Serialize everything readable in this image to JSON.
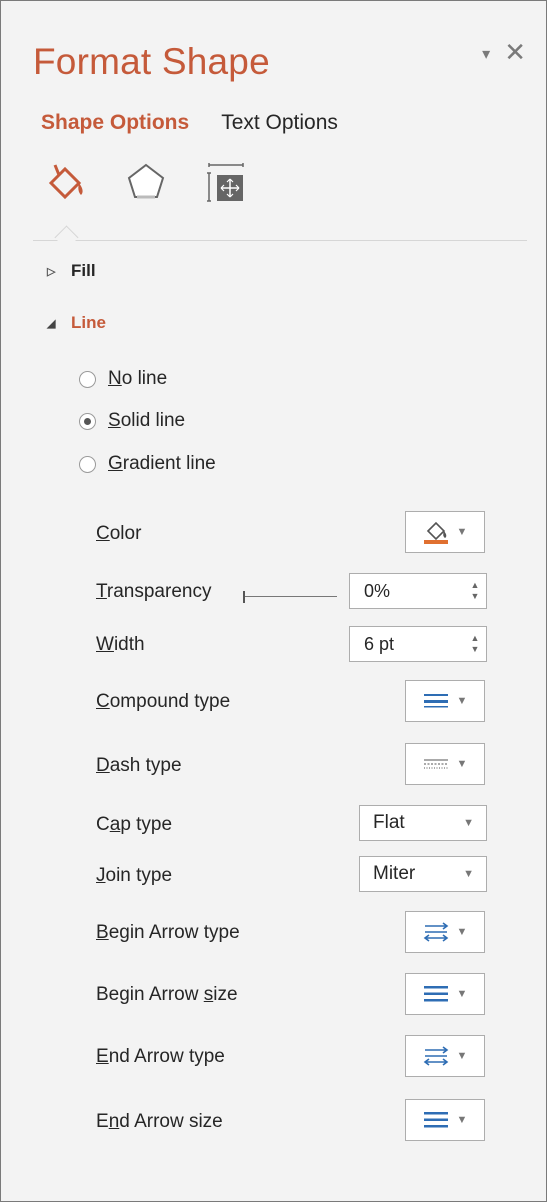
{
  "panel": {
    "title": "Format Shape",
    "tabs": [
      {
        "label": "Shape Options",
        "active": true
      },
      {
        "label": "Text Options",
        "active": false
      }
    ],
    "category_icons": [
      "fill-line-icon",
      "effects-pentagon-icon",
      "size-properties-icon"
    ],
    "accent_color": "#c55a3a"
  },
  "sections": {
    "fill": {
      "label": "Fill",
      "expanded": false
    },
    "line": {
      "label": "Line",
      "expanded": true
    }
  },
  "line_options": [
    {
      "label": "No line",
      "accel": "N",
      "rest": "o line",
      "checked": false
    },
    {
      "label": "Solid line",
      "accel": "S",
      "rest": "olid line",
      "checked": true
    },
    {
      "label": "Gradient line",
      "accel": "G",
      "rest": "radient line",
      "checked": false
    }
  ],
  "properties": {
    "color": {
      "label": "Color",
      "accel": "C",
      "rest": "olor",
      "swatch": "#e07030"
    },
    "transparency": {
      "label": "Transparency",
      "accel": "T",
      "rest": "ransparency",
      "value": "0%",
      "level": 0
    },
    "width": {
      "label": "Width",
      "accel": "W",
      "rest": "idth",
      "value": "6 pt"
    },
    "compound_type": {
      "label": "Compound type",
      "accel": "C",
      "rest": "ompound type"
    },
    "dash_type": {
      "label": "Dash type",
      "accel": "D",
      "rest": "ash type"
    },
    "cap_type": {
      "label": "Cap type",
      "pre": "C",
      "accel": "a",
      "rest": "p type",
      "value": "Flat"
    },
    "join_type": {
      "label": "Join type",
      "accel": "J",
      "rest": "oin type",
      "value": "Miter"
    },
    "begin_arrow_type": {
      "label": "Begin Arrow type",
      "accel": "B",
      "rest": "egin Arrow type"
    },
    "begin_arrow_size": {
      "label": "Begin Arrow size",
      "pre": "Begin Arrow ",
      "accel": "s",
      "rest": "ize"
    },
    "end_arrow_type": {
      "label": "End Arrow type",
      "accel": "E",
      "rest": "nd Arrow type"
    },
    "end_arrow_size": {
      "label": "End Arrow size",
      "pre": "E",
      "accel": "n",
      "rest": "d Arrow size"
    }
  }
}
